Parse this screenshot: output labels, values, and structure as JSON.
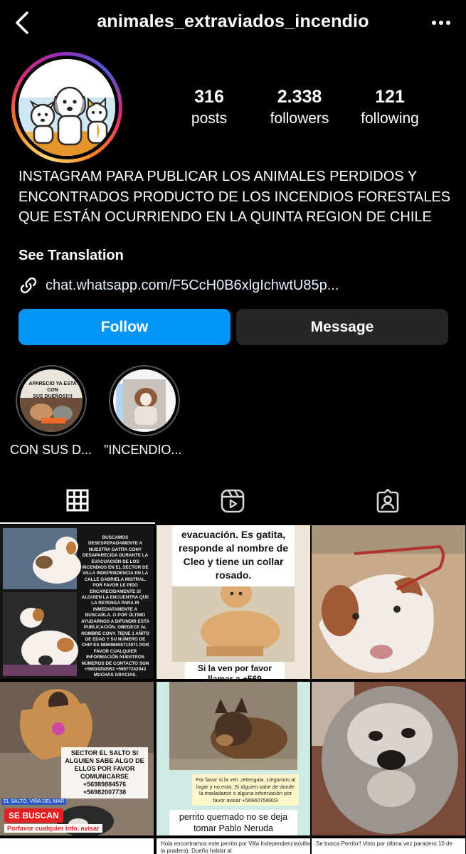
{
  "header": {
    "username": "animales_extraviados_incendio",
    "back_icon": "chevron-left-icon",
    "more_icon": "more-horizontal-icon"
  },
  "stats": {
    "posts": {
      "value": "316",
      "label": "posts"
    },
    "followers": {
      "value": "2.338",
      "label": "followers"
    },
    "following": {
      "value": "121",
      "label": "following"
    }
  },
  "bio": {
    "text": "INSTAGRAM PARA PUBLICAR LOS ANIMALES PERDIDOS Y ENCONTRADOS PRODUCTO DE LOS INCENDIOS FORESTALES QUE ESTÁN OCURRIENDO EN LA QUINTA REGION DE CHILE",
    "see_translation": "See Translation",
    "link": "chat.whatsapp.com/F5CcH0B6xlgIchwtU85p..."
  },
  "actions": {
    "follow": "Follow",
    "message": "Message"
  },
  "highlights": [
    {
      "label": "CON SUS D...",
      "cover_text": [
        "APARECIO YA ESTA CON",
        "SUS DUEÑOS!!!!"
      ]
    },
    {
      "label": "\"INCENDIO..."
    }
  ],
  "tabs": [
    {
      "icon": "grid-icon",
      "active": true
    },
    {
      "icon": "reels-icon",
      "active": false
    },
    {
      "icon": "tagged-icon",
      "active": false
    }
  ],
  "posts": {
    "p1": {
      "text": "BUSCAMOS DESESPERADAMENTE A NUESTRA GATITA CONY DESAPARECIDA DURANTE LA EVACUACIÓN DE LOS INCENDIOS EN EL SECTOR DE VILLA INDEPENDENCIA EN LA CALLE GABRIELA MISTRAL. POR FAVOR LE PIDO ENCARECIDAMENTE SI ALGUIEN LA ENCUENTRA QUE LA RETENGA PARA IR INMEDIATAMENTE A BUSCARLA. O POR ÚLTIMO AYUDARNOS A DIFUNDIR ESTA PUBLICACIÓN. OBEDECE AL NOMBRE CONY. TIENE 1 AÑITO DE EDAD Y SU NÚMERO DE CHIP ES 985098000713971 POR FAVOR CUALQUIER INFORMACIÓN NUESTROS NÚMEROS DE CONTACTO SON +56934292953 +56977242043 MUCHAS GRACIAS. #INCENDIOSFORESTALES #INCENDIOS #INCENDIOFORESTAL #INCENDIOSFORESTALES #VIÑADELMAR #INCENDIOSVIÑADELMAR"
    },
    "p2": {
      "head": "evacuación. Es gatita, responde al nombre de Cleo y tiene un collar rosado.",
      "foot": "Si la ven por favor llamar a +569"
    },
    "p4": {
      "sector": "SECTOR EL SALTO SI ALGUIEN SABE ALGO DE ELLOS POR FAVOR COMUNICARSE +56989884576 +56982007738",
      "location": "EL SALTO, VIÑA DEL MAR",
      "badge": "SE BUSCAN",
      "porfavor": "Porfavor cualquier info. avisar"
    },
    "p5": {
      "msg": "Por favor si la ven ,retengala. Llegamos al lugar y no esta. Si alguien sabe de donde la trasladaron o alguna información por favor avisar +56940756903",
      "caption": "perrito quemado no se deja tomar Pablo Neruda"
    },
    "p7": {
      "text": ""
    },
    "p8": {
      "text": "Hola encontramos este perrito por Villa Independencia(villa la pradera). Dueño hablar al"
    },
    "p9": {
      "text": "Se busca Perrito!! Visto por última vez paradero 10 de"
    }
  },
  "colors": {
    "follow_blue": "#0095f6",
    "message_gray": "#262626",
    "background": "#000000"
  }
}
